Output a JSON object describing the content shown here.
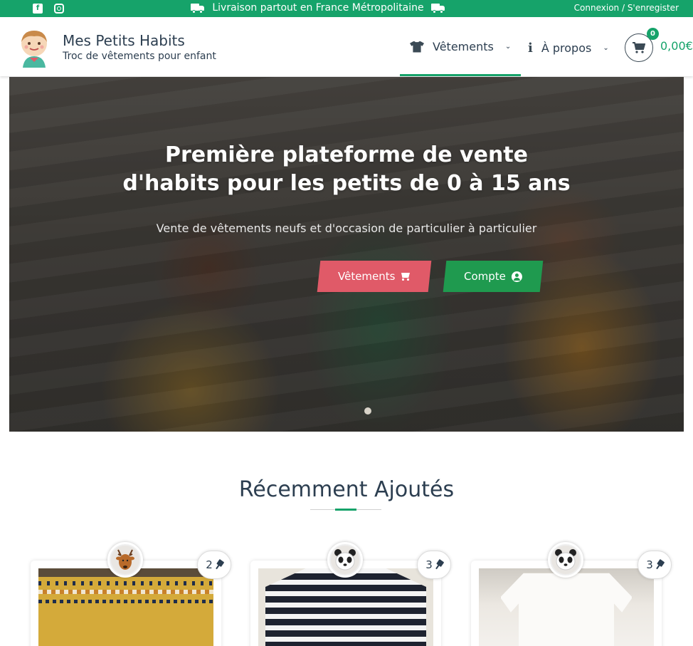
{
  "topbar": {
    "social": [
      "facebook-icon",
      "instagram-icon"
    ],
    "shipping_text": "Livraison partout en France Métropolitaine",
    "auth_text": "Connexion / S'enregister"
  },
  "brand": {
    "title": "Mes Petits Habits",
    "subtitle": "Troc de vêtements pour enfant"
  },
  "nav": {
    "items": [
      {
        "label": "Vêtements",
        "icon": "tshirt-icon",
        "active": true
      },
      {
        "label": "À propos",
        "icon": "info-icon",
        "active": false
      }
    ],
    "cart_count": "0",
    "cart_total": "0,00€"
  },
  "hero": {
    "title_line1": "Première plateforme de vente",
    "title_line2": "d'habits pour les petits de 0 à 15 ans",
    "subtitle": "Vente de vêtements neufs et d'occasion de particulier à particulier",
    "btn_primary": "Vêtements",
    "btn_secondary": "Compte"
  },
  "recent": {
    "title": "Récemment Ajoutés",
    "cards": [
      {
        "avatar": "deer-icon",
        "pins": "2"
      },
      {
        "avatar": "panda-icon",
        "pins": "3"
      },
      {
        "avatar": "panda-icon",
        "pins": "3"
      }
    ]
  },
  "colors": {
    "accent": "#16a36a",
    "btn_primary": "#e05a68",
    "btn_secondary": "#1f9a4f",
    "text_dark": "#2c3e50"
  }
}
